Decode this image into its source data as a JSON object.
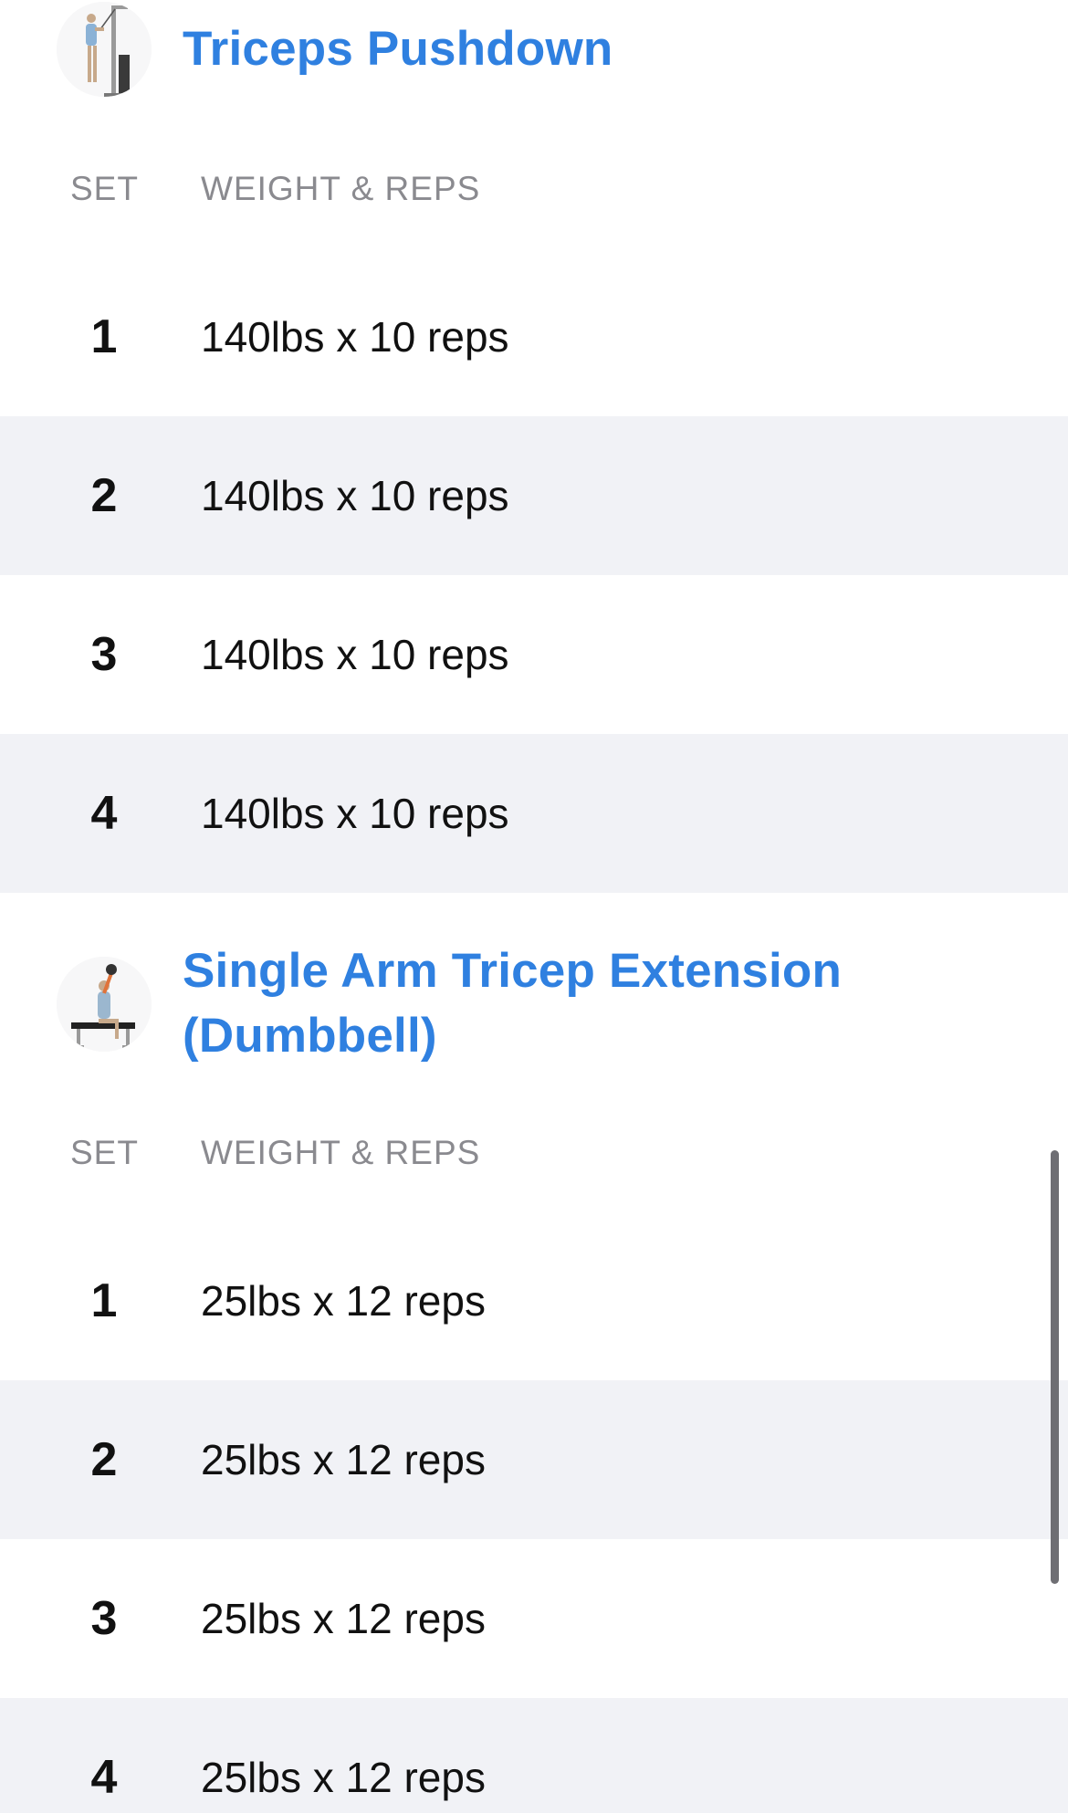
{
  "exercises": [
    {
      "title": "Triceps Pushdown",
      "thumbnail_icon": "cable-pushdown-icon",
      "columns": {
        "set": "SET",
        "weight_reps": "WEIGHT & REPS"
      },
      "sets": [
        {
          "num": "1",
          "value": "140lbs x 10 reps"
        },
        {
          "num": "2",
          "value": "140lbs x 10 reps"
        },
        {
          "num": "3",
          "value": "140lbs x 10 reps"
        },
        {
          "num": "4",
          "value": "140lbs x 10 reps"
        }
      ]
    },
    {
      "title": "Single Arm Tricep Extension (Dumbbell)",
      "thumbnail_icon": "dumbbell-extension-icon",
      "columns": {
        "set": "SET",
        "weight_reps": "WEIGHT & REPS"
      },
      "sets": [
        {
          "num": "1",
          "value": "25lbs x 12 reps"
        },
        {
          "num": "2",
          "value": "25lbs x 12 reps"
        },
        {
          "num": "3",
          "value": "25lbs x 12 reps"
        },
        {
          "num": "4",
          "value": "25lbs x 12 reps"
        }
      ]
    }
  ],
  "colors": {
    "title_blue": "#2f80e0",
    "row_shade": "#f1f2f6",
    "header_gray": "#8a8a8f"
  }
}
